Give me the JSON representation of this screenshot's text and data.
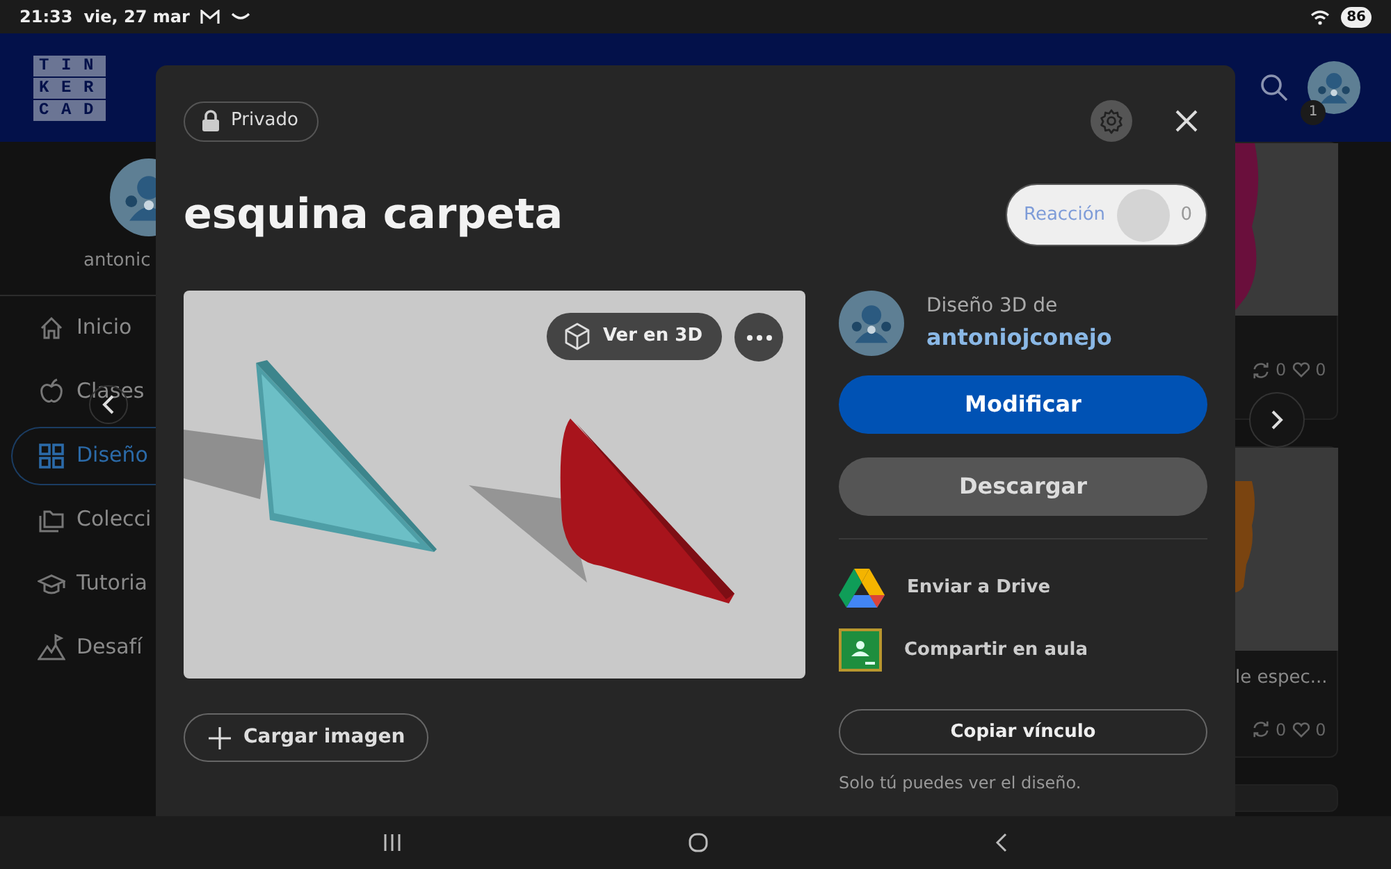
{
  "status_bar": {
    "time": "21:33",
    "date": "vie, 27 mar",
    "battery": "86"
  },
  "header": {
    "logo": [
      "TIN",
      "KER",
      "CAD"
    ],
    "notification_count": "1"
  },
  "sidebar": {
    "username": "antonic",
    "items": [
      {
        "label": "Inicio",
        "selected": false
      },
      {
        "label": "Clases",
        "selected": false
      },
      {
        "label": "Diseño",
        "selected": true
      },
      {
        "label": "Colecci",
        "selected": false
      },
      {
        "label": "Tutoria",
        "selected": false
      },
      {
        "label": "Desafí",
        "selected": false
      }
    ]
  },
  "background_cards": [
    {
      "remixes": "0",
      "likes": "0"
    },
    {
      "title": "le espec...",
      "remixes": "0",
      "likes": "0"
    }
  ],
  "modal": {
    "visibility": "Privado",
    "title": "esquina carpeta",
    "reaction": {
      "label": "Reacción",
      "count": "0"
    },
    "preview": {
      "view_3d": "Ver en 3D"
    },
    "upload": "Cargar imagen",
    "author": {
      "caption": "Diseño 3D de",
      "name": "antoniojconejo"
    },
    "buttons": [
      {
        "label": "Modificar",
        "kind": "primary"
      },
      {
        "label": "Descargar",
        "kind": "secondary"
      }
    ],
    "share": [
      {
        "label": "Enviar a Drive",
        "kind": "drive"
      },
      {
        "label": "Compartir en aula",
        "kind": "classroom"
      }
    ],
    "copy_link": "Copiar vínculo",
    "note": "Solo tú puedes ver el diseño."
  }
}
